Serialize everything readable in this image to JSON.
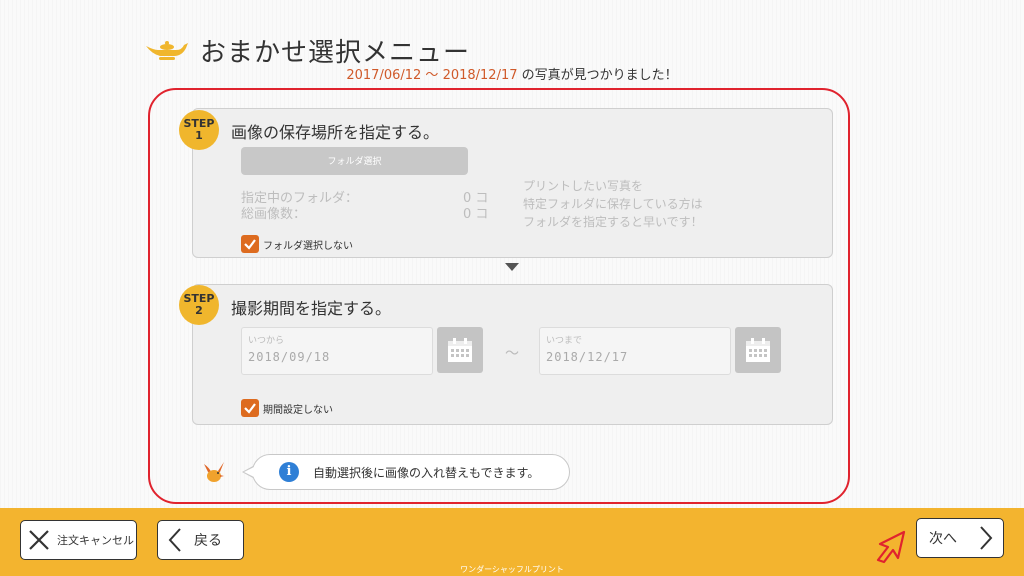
{
  "header": {
    "title": "おまかせ選択メニュー",
    "found_from": "2017/06/12",
    "found_sep": " ～ ",
    "found_to": "2018/12/17",
    "found_suffix": " の写真が見つかりました！",
    "lamp_icon": "genie-lamp-icon"
  },
  "step1": {
    "badge_step": "STEP",
    "badge_num": "1",
    "title": "画像の保存場所を指定する。",
    "folder_button": "フォルダ選択",
    "label_folder": "指定中のフォルダ：",
    "label_count": "総画像数：",
    "value_folder": "0 コ",
    "value_count": "0 コ",
    "hint_line1": "プリントしたい写真を",
    "hint_line2": "特定フォルダに保存している方は",
    "hint_line3": "フォルダを指定すると早いです！",
    "checkbox_label": "フォルダ選択しない"
  },
  "step2": {
    "badge_step": "STEP",
    "badge_num": "2",
    "title": "撮影期間を指定する。",
    "from_caption": "いつから",
    "from_value": "2018/09/18",
    "to_caption": "いつまで",
    "to_value": "2018/12/17",
    "tilde": "～",
    "checkbox_label": "期間設定しない"
  },
  "tip": {
    "text": "自動選択後に画像の入れ替えもできます。",
    "icon": "i"
  },
  "footer": {
    "cancel_label": "注文キャンセル",
    "back_label": "戻る",
    "next_label": "次へ",
    "caption": "ワンダーシャッフルプリント"
  },
  "colors": {
    "accent": "#f3b42f",
    "highlight_frame": "#e0232e",
    "date_text": "#d05a2a",
    "checkbox": "#dd6b1f",
    "info": "#2f7fd6"
  }
}
